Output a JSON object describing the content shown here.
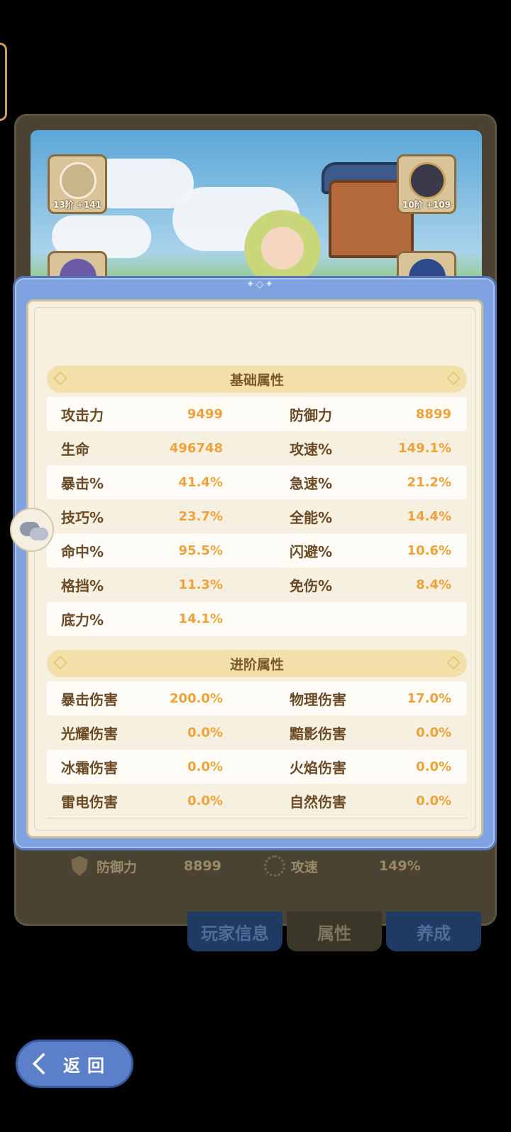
{
  "equipment": {
    "slot_left_top": {
      "level": "13阶 +141",
      "icon": "bow-icon"
    },
    "slot_right_top": {
      "level": "10阶 +109",
      "icon": "helmet-icon"
    }
  },
  "background_stats": {
    "defense_label": "防御力",
    "defense_value": "8899",
    "speed_label": "攻速",
    "speed_value": "149%"
  },
  "tabs": [
    {
      "label": "玩家信息",
      "active": false
    },
    {
      "label": "属性",
      "active": true
    },
    {
      "label": "养成",
      "active": false
    }
  ],
  "modal": {
    "basic_section": {
      "title": "基础属性",
      "rows": [
        [
          {
            "label": "攻击力",
            "value": "9499"
          },
          {
            "label": "防御力",
            "value": "8899"
          }
        ],
        [
          {
            "label": "生命",
            "value": "496748"
          },
          {
            "label": "攻速%",
            "value": "149.1%"
          }
        ],
        [
          {
            "label": "暴击%",
            "value": "41.4%"
          },
          {
            "label": "急速%",
            "value": "21.2%"
          }
        ],
        [
          {
            "label": "技巧%",
            "value": "23.7%"
          },
          {
            "label": "全能%",
            "value": "14.4%"
          }
        ],
        [
          {
            "label": "命中%",
            "value": "95.5%"
          },
          {
            "label": "闪避%",
            "value": "10.6%"
          }
        ],
        [
          {
            "label": "格挡%",
            "value": "11.3%"
          },
          {
            "label": "免伤%",
            "value": "8.4%"
          }
        ],
        [
          {
            "label": "底力%",
            "value": "14.1%"
          }
        ]
      ]
    },
    "advanced_section": {
      "title": "进阶属性",
      "rows": [
        [
          {
            "label": "暴击伤害",
            "value": "200.0%"
          },
          {
            "label": "物理伤害",
            "value": "17.0%"
          }
        ],
        [
          {
            "label": "光耀伤害",
            "value": "0.0%"
          },
          {
            "label": "黯影伤害",
            "value": "0.0%"
          }
        ],
        [
          {
            "label": "冰霜伤害",
            "value": "0.0%"
          },
          {
            "label": "火焰伤害",
            "value": "0.0%"
          }
        ],
        [
          {
            "label": "雷电伤害",
            "value": "0.0%"
          },
          {
            "label": "自然伤害",
            "value": "0.0%"
          }
        ]
      ]
    }
  },
  "back_button": {
    "label": "返回"
  },
  "colors": {
    "modal_frame": "#7fa3e0",
    "panel_bg": "#f6f0e1",
    "stat_value": "#f0a23a",
    "stat_label": "#6b4a26"
  }
}
